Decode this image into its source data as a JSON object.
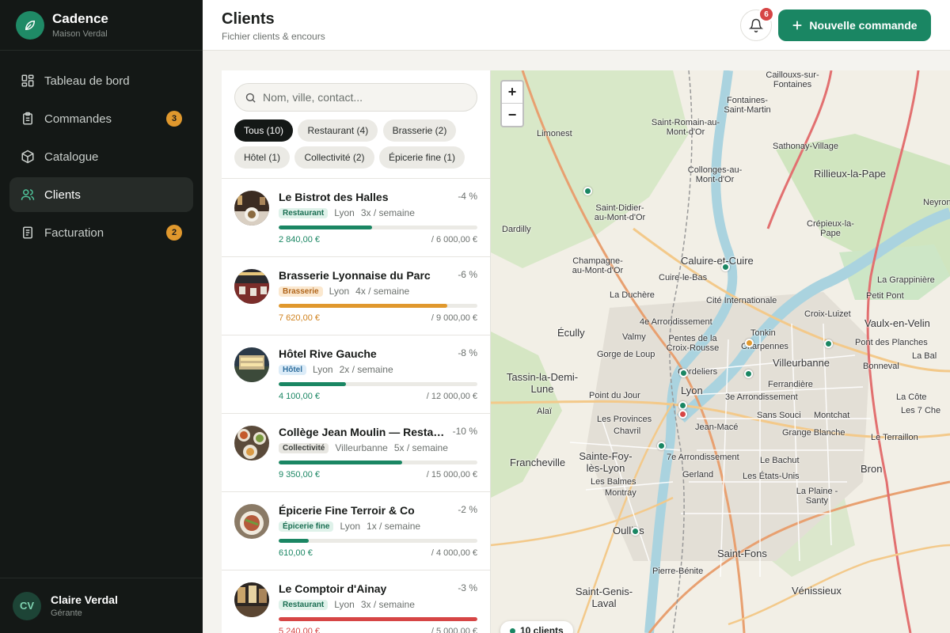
{
  "brand": {
    "name": "Cadence",
    "subtitle": "Maison Verdal"
  },
  "nav": [
    {
      "label": "Tableau de bord",
      "icon": "dashboard-icon"
    },
    {
      "label": "Commandes",
      "icon": "clipboard-icon",
      "badge": "3"
    },
    {
      "label": "Catalogue",
      "icon": "box-icon"
    },
    {
      "label": "Clients",
      "icon": "users-icon",
      "active": true
    },
    {
      "label": "Facturation",
      "icon": "invoice-icon",
      "badge": "2"
    }
  ],
  "user": {
    "initials": "CV",
    "name": "Claire Verdal",
    "role": "Gérante"
  },
  "header": {
    "title": "Clients",
    "subtitle": "Fichier clients & encours",
    "notifications": "6",
    "cta_label": "Nouvelle commande"
  },
  "search": {
    "placeholder": "Nom, ville, contact..."
  },
  "filters": [
    "Tous (10)",
    "Restaurant (4)",
    "Brasserie (2)",
    "Hôtel (1)",
    "Collectivité (2)",
    "Épicerie fine (1)"
  ],
  "clients": [
    {
      "name": "Le Bistrot des Halles",
      "delta": "-4 %",
      "type": "Restaurant",
      "city": "Lyon",
      "frequency": "3x / semaine",
      "amount": "2 840,00 €",
      "limit": "/ 6 000,00 €",
      "usage": 0.47
    },
    {
      "name": "Brasserie Lyonnaise du Parc",
      "delta": "-6 %",
      "type": "Brasserie",
      "city": "Lyon",
      "frequency": "4x / semaine",
      "amount": "7 620,00 €",
      "limit": "/ 9 000,00 €",
      "usage": 0.85
    },
    {
      "name": "Hôtel Rive Gauche",
      "delta": "-8 %",
      "type": "Hôtel",
      "city": "Lyon",
      "frequency": "2x / semaine",
      "amount": "4 100,00 €",
      "limit": "/ 12 000,00 €",
      "usage": 0.34
    },
    {
      "name": "Collège Jean Moulin — Restauration",
      "delta": "-10 %",
      "type": "Collectivité",
      "city": "Villeurbanne",
      "frequency": "5x / semaine",
      "amount": "9 350,00 €",
      "limit": "/ 15 000,00 €",
      "usage": 0.62
    },
    {
      "name": "Épicerie Fine Terroir & Co",
      "delta": "-2 %",
      "type": "Épicerie fine",
      "city": "Lyon",
      "frequency": "1x / semaine",
      "amount": "610,00 €",
      "limit": "/ 4 000,00 €",
      "usage": 0.15
    },
    {
      "name": "Le Comptoir d'Ainay",
      "delta": "-3 %",
      "type": "Restaurant",
      "city": "Lyon",
      "frequency": "3x / semaine",
      "amount": "5 240,00 €",
      "limit": "/ 5 000,00 €",
      "usage": 1.0
    }
  ],
  "colors": {
    "accent": "#1a8663",
    "warning": "#e0982d",
    "danger": "#d64545",
    "sidebar": "#141816"
  },
  "map": {
    "zoom_in": "+",
    "zoom_out": "−",
    "clients_count": "10 clients",
    "places": [
      "Limonest",
      "Saint-Romain-au-Mont-d'Or",
      "Fontaines-Saint-Martin",
      "Sathonay-Village",
      "Collonges-au-Mont-d'Or",
      "Rillieux-la-Pape",
      "Saint-Didier-au-Mont-d'Or",
      "Dardilly",
      "Crépieux-la-Pape",
      "Champagne-au-Mont-d'Or",
      "Caluire-et-Cuire",
      "Cuire-le-Bas",
      "La Duchère",
      "Cité Internationale",
      "La Grappinière",
      "Petit Pont",
      "Écully",
      "4e Arrondissement",
      "Croix-Luizet",
      "Vaulx-en-Velin",
      "Valmy",
      "Pentes de la Croix-Rousse",
      "Tonkin",
      "Charpennes",
      "Pont des Planches",
      "Gorge de Loup",
      "Cordeliers",
      "Villeurbanne",
      "Bonneval",
      "Tassin-la-Demi-Lune",
      "Lyon",
      "Ferrandière",
      "Point du Jour",
      "3e Arrondissement",
      "Alaï",
      "Les Provinces",
      "Jean-Macé",
      "Sans Souci",
      "Montchat",
      "Chavril",
      "Grange Blanche",
      "Le Terraillon",
      "Francheville",
      "Sainte-Foy-lès-Lyon",
      "7e Arrondissement",
      "Le Bachut",
      "Bron",
      "Les Balmes",
      "Montray",
      "Gerland",
      "Les États-Unis",
      "La Plaine - Santy",
      "Oullins",
      "Pierre-Bénite",
      "Saint-Fons",
      "Saint-Genis-Laval",
      "Vénissieux",
      "Caillouxs-sur-Fontaines",
      "Neyron",
      "La Côte",
      "Les 7 Che",
      "La Bal"
    ]
  }
}
